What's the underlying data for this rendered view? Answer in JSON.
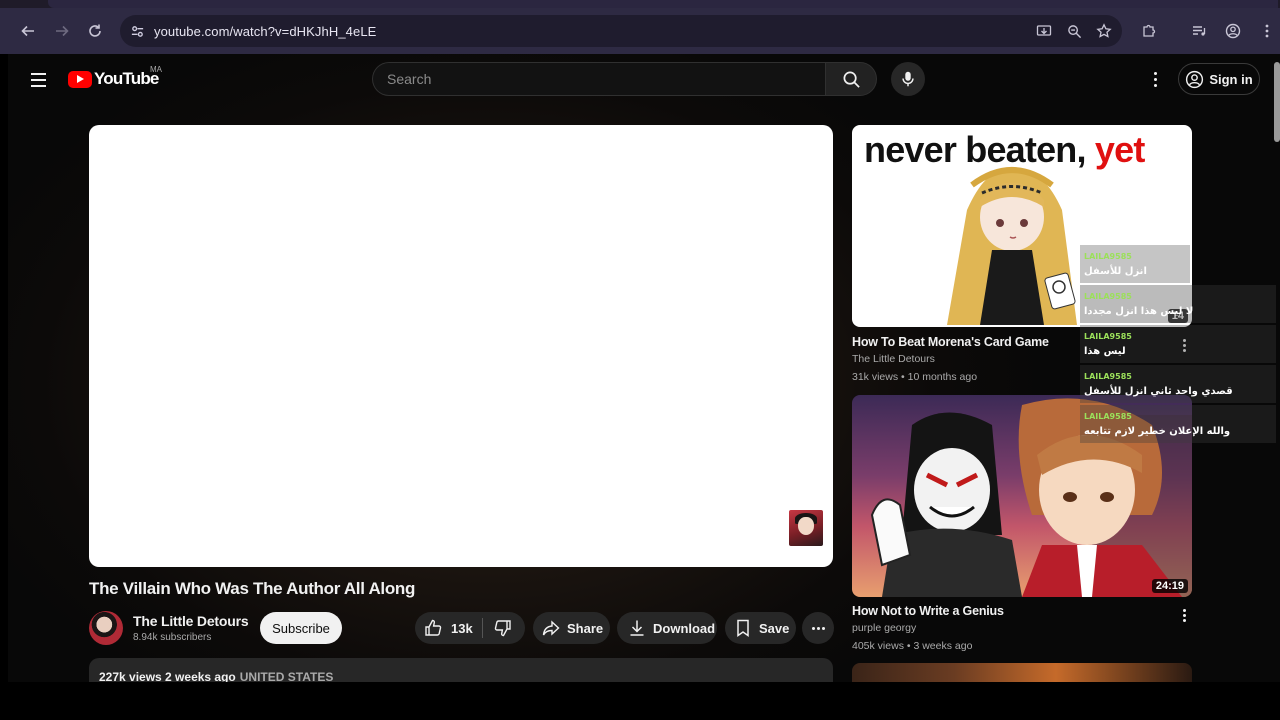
{
  "browser": {
    "url": "youtube.com/watch?v=dHKJhH_4eLE"
  },
  "header": {
    "logo_text": "YouTube",
    "country_code": "MA",
    "search_placeholder": "Search",
    "signin_label": "Sign in"
  },
  "video": {
    "title": "The Villain Who Was The Author All Along",
    "channel": "The Little Detours",
    "subscribers": "8.94k subscribers",
    "subscribe_label": "Subscribe",
    "likes": "13k",
    "share_label": "Share",
    "download_label": "Download",
    "save_label": "Save",
    "description_meta": "227k views  2 weeks ago",
    "description_location": "UNITED STATES"
  },
  "recommendations": [
    {
      "thumb_text": "never beaten,",
      "thumb_text_accent": "yet",
      "duration": "14",
      "title": "How To Beat Morena's Card Game",
      "channel": "The Little Detours",
      "meta": "31k views • 10 months ago"
    },
    {
      "duration": "24:19",
      "title": "How Not to Write a Genius",
      "channel": "purple georgy",
      "meta": "405k views • 3 weeks ago"
    }
  ],
  "live_chat": [
    {
      "author": "LAILA9585",
      "text": "انزل للأسفل"
    },
    {
      "author": "LAILA9585",
      "text": "لا ليس هذا انزل مجددا"
    },
    {
      "author": "LAILA9585",
      "text": "ليس هذا"
    },
    {
      "author": "LAILA9585",
      "text": "قصدي واحد ثاني انزل للأسفل"
    },
    {
      "author": "LAILA9585",
      "text": "والله الإعلان خطير لازم تتابعه"
    }
  ]
}
